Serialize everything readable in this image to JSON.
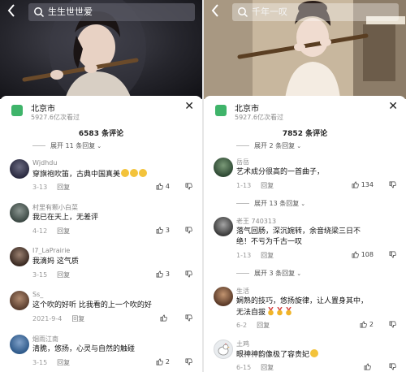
{
  "panels": [
    {
      "search_text": "生生世世爱",
      "location": "北京市",
      "views": "5927.6亿次看过",
      "comment_count": "6583 条评论",
      "expand_top": "展开 11 条回复",
      "comments": [
        {
          "user": "Wjdhdu",
          "text": "穿旗袍吹笛，古典中国真美",
          "date": "3-13",
          "reply": "回复",
          "likes": "4"
        },
        {
          "user": "村里有颗小白菜",
          "text": "我已在天上，无差评",
          "date": "4-12",
          "reply": "回复",
          "likes": "3"
        },
        {
          "user": "I7_LaPrairie",
          "text": "我滴妈 这气质",
          "date": "3-15",
          "reply": "回复",
          "likes": "3"
        },
        {
          "user": "Ss_",
          "text": "这个吹的好听 比我看的上一个吹的好",
          "date": "2021-9-4",
          "reply": "回复",
          "likes": ""
        },
        {
          "user": "烟雨江南",
          "text": "清脆，悠扬，心灵与自然的触碰",
          "date": "3-15",
          "reply": "回复",
          "likes": "2"
        }
      ]
    },
    {
      "search_text": "千年一叹",
      "location": "北京市",
      "views": "5927.6亿次看过",
      "comment_count": "7852 条评论",
      "expand_top": "展开 2 条回复",
      "expand_mid1": "展开 13 条回复",
      "expand_mid2": "展开 3 条回复",
      "comments": [
        {
          "user": "岳岳",
          "text": "艺术成分很高的一首曲子，",
          "date": "1-13",
          "reply": "回复",
          "likes": "134"
        },
        {
          "user": "老王 740313",
          "text": "落气回肠，深沉婉转，余音绕梁三日不绝！不亏为千古一叹",
          "date": "1-13",
          "reply": "回复",
          "likes": "108"
        },
        {
          "user": "生活",
          "text": "娴熟的技巧，悠扬旋律，让人置身其中，无法自拔",
          "date": "6-2",
          "reply": "回复",
          "likes": "2"
        },
        {
          "user": "土鸡",
          "text": "眼神神韵像极了容贵妃",
          "date": "6-15",
          "reply": "回复",
          "likes": ""
        }
      ]
    }
  ],
  "icons": {
    "back": "chevron-left-icon",
    "search": "search-icon",
    "location": "location-pin-icon",
    "close": "close-icon",
    "like": "thumbs-up-icon",
    "dislike": "thumbs-down-icon",
    "expand": "chevron-down-icon"
  },
  "colors": {
    "location_green": "#3fb46a",
    "muted_text": "#8a8a8a"
  }
}
